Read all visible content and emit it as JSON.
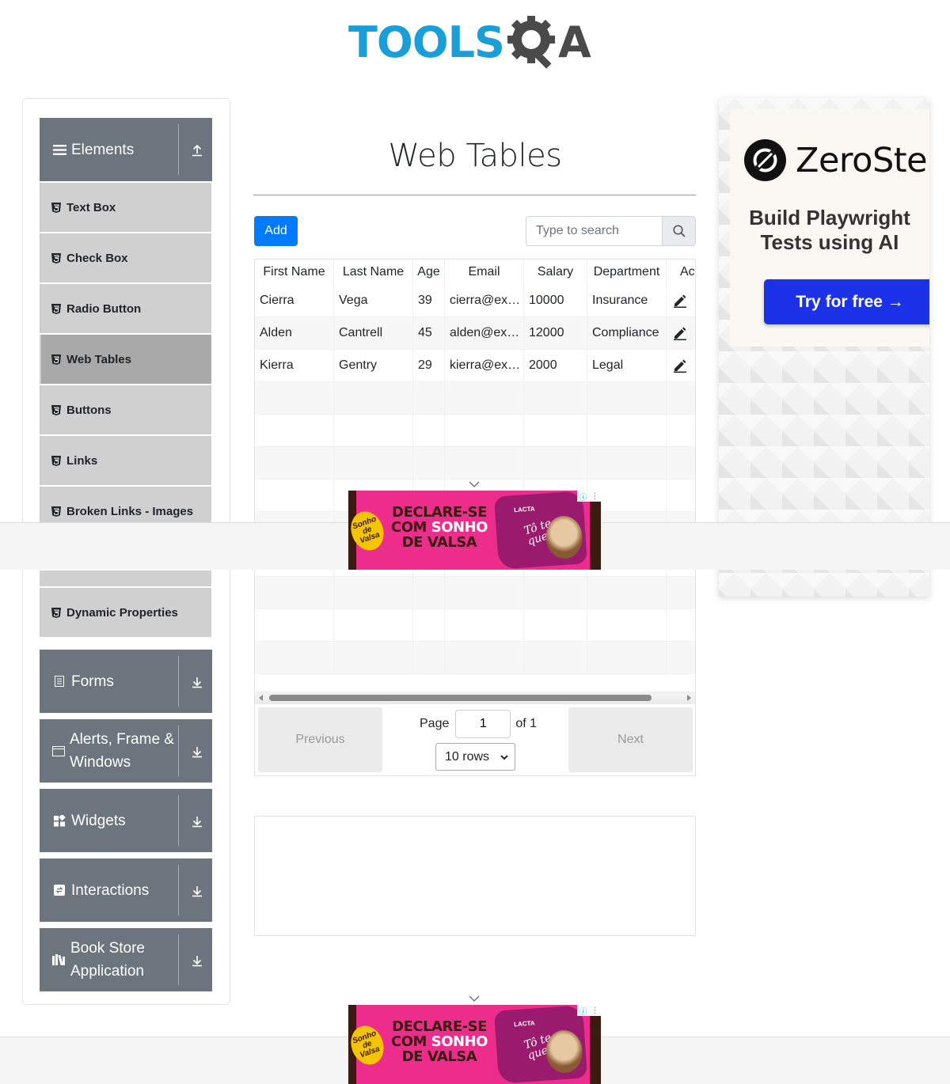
{
  "brand": {
    "logo_left": "TOOLS",
    "logo_right": "A"
  },
  "sidebar": {
    "groups": [
      {
        "label": "Elements",
        "icon": "hamburger-icon",
        "arrow": "collapse-arrow-up-icon"
      },
      {
        "label": "Forms",
        "icon": "form-icon",
        "arrow": "expand-arrow-down-icon"
      },
      {
        "label": "Alerts, Frame & Windows",
        "icon": "window-icon",
        "arrow": "expand-arrow-down-icon"
      },
      {
        "label": "Widgets",
        "icon": "widgets-icon",
        "arrow": "expand-arrow-down-icon"
      },
      {
        "label": "Interactions",
        "icon": "interactions-icon",
        "arrow": "expand-arrow-down-icon"
      },
      {
        "label": "Book Store Application",
        "icon": "books-icon",
        "arrow": "expand-arrow-down-icon"
      }
    ],
    "element_items": [
      {
        "label": "Text Box",
        "active": false
      },
      {
        "label": "Check Box",
        "active": false
      },
      {
        "label": "Radio Button",
        "active": false
      },
      {
        "label": "Web Tables",
        "active": true
      },
      {
        "label": "Buttons",
        "active": false
      },
      {
        "label": "Links",
        "active": false
      },
      {
        "label": "Broken Links - Images",
        "active": false
      },
      {
        "label": "Dynamic Properties",
        "active": false
      }
    ]
  },
  "main": {
    "title": "Web Tables",
    "add_label": "Add",
    "search_placeholder": "Type to search",
    "table": {
      "columns": [
        "First Name",
        "Last Name",
        "Age",
        "Email",
        "Salary",
        "Department",
        "Action"
      ],
      "rows": [
        [
          "Cierra",
          "Vega",
          "39",
          "cierra@ex…",
          "10000",
          "Insurance"
        ],
        [
          "Alden",
          "Cantrell",
          "45",
          "alden@ex…",
          "12000",
          "Compliance"
        ],
        [
          "Kierra",
          "Gentry",
          "29",
          "kierra@ex…",
          "2000",
          "Legal"
        ]
      ],
      "visible_header_action": "Ac"
    },
    "pagination": {
      "previous_label": "Previous",
      "next_label": "Next",
      "page_label": "Page",
      "page_value": "1",
      "of_label": "of 1",
      "rows_label": "10 rows"
    }
  },
  "ads": {
    "zerostep": {
      "name": "ZeroStep",
      "tagline": "Build Playwright Tests using AI",
      "cta": "Try for free →"
    },
    "banner": {
      "line1": "DECLARE-SE",
      "line2a": "COM",
      "line2b": "SONHO",
      "line3": "DE VALSA",
      "brand": "LACTA",
      "script": "Tô te querendo",
      "badge": "Sonho de Valsa"
    }
  },
  "colors": {
    "primary": "#007bff",
    "sidebar_group": "#6c757d",
    "sidebar_item": "#d0d0d0",
    "sidebar_active": "#a9a9a9",
    "brand_blue": "#1a9ed8",
    "cta_blue": "#1b32e8",
    "banner_pink": "#ec2d8b"
  }
}
